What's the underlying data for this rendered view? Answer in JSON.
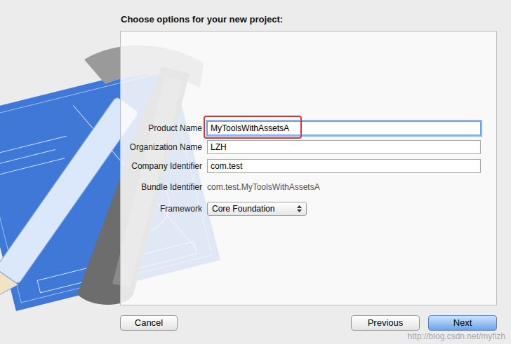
{
  "dialog": {
    "heading": "Choose options for your new project:"
  },
  "fields": [
    {
      "label": "Product Name",
      "kind": "text",
      "value": "MyToolsWithAssetsA",
      "focused": true,
      "highlighted": true
    },
    {
      "label": "Organization Name",
      "kind": "text",
      "value": "LZH",
      "focused": false,
      "highlighted": false
    },
    {
      "label": "Company Identifier",
      "kind": "text",
      "value": "com.test",
      "focused": false,
      "highlighted": false
    },
    {
      "label": "Bundle Identifier",
      "kind": "static",
      "value": "com.test.MyToolsWithAssetsA",
      "focused": false,
      "highlighted": false
    },
    {
      "label": "Framework",
      "kind": "popup",
      "value": "Core Foundation",
      "focused": false,
      "highlighted": false
    }
  ],
  "buttons": [
    {
      "label": "Cancel",
      "default": false
    },
    {
      "label": "Previous",
      "default": false
    },
    {
      "label": "Next",
      "default": true
    }
  ],
  "watermark": "http://blog.csdn.net/myfizh"
}
